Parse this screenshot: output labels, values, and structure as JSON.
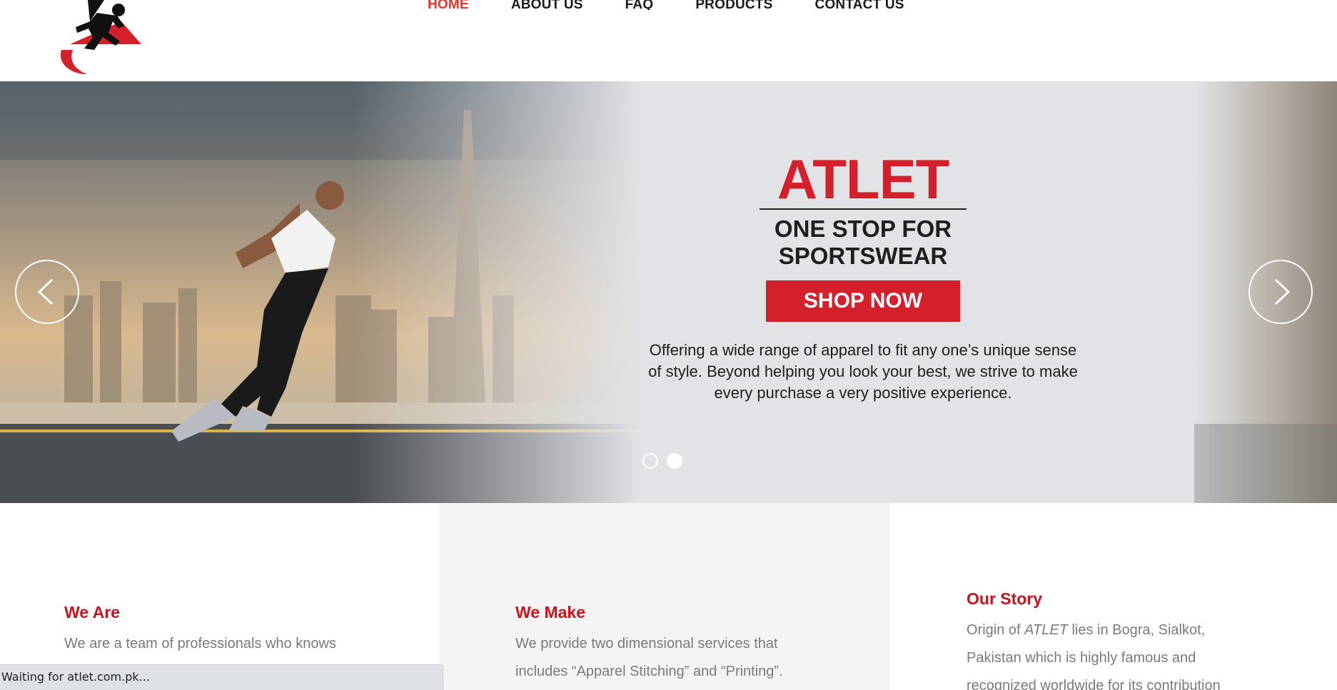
{
  "brand": {
    "logo": "running-man-logo",
    "colors": {
      "accent": "#d4202a",
      "nav_active": "#e8342e",
      "heading": "#c8141c",
      "body_text": "#7a7a7a"
    }
  },
  "nav": {
    "items": [
      {
        "label": "HOME",
        "active": true
      },
      {
        "label": "ABOUT US",
        "active": false
      },
      {
        "label": "FAQ",
        "active": false
      },
      {
        "label": "PRODUCTS",
        "active": false
      },
      {
        "label": "CONTACT US",
        "active": false
      }
    ]
  },
  "hero": {
    "title": "ATLET",
    "subtitle_line1": "ONE STOP FOR",
    "subtitle_line2": "SPORTSWEAR",
    "cta_label": "SHOP NOW",
    "description_line1": "Offering a wide range of apparel to fit any one’s unique sense",
    "description_line2": "of style. Beyond helping you look your best, we strive to make",
    "description_line3": "every purchase a very positive experience.",
    "prev_icon": "chevron-left-icon",
    "next_icon": "chevron-right-icon",
    "slides_total": 2,
    "slide_active": 2
  },
  "sections": {
    "we_are": {
      "title": "We Are",
      "text": "We are a team of professionals who knows"
    },
    "we_make": {
      "title": "We Make",
      "text_line1": "We provide two dimensional services that",
      "text_line2": "includes “Apparel Stitching” and “Printing”."
    },
    "our_story": {
      "title": "Our Story",
      "text_pre": "Origin of ",
      "text_em": "ATLET",
      "text_post": " lies in Bogra, Sialkot,",
      "text_line2": "Pakistan which is highly famous and",
      "text_line3": "recognized worldwide for its contribution"
    }
  },
  "status_bar": {
    "text": "Waiting for atlet.com.pk..."
  }
}
